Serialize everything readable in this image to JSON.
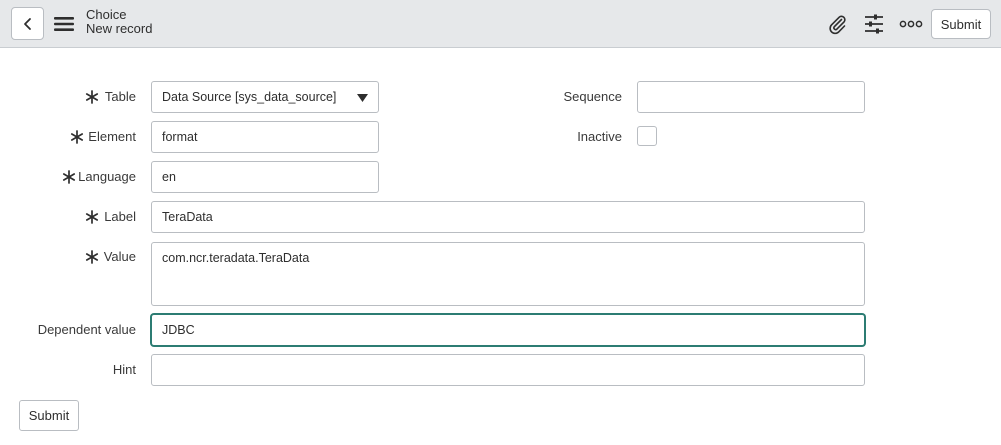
{
  "header": {
    "title": "Choice",
    "subtitle": "New record",
    "submit_label": "Submit",
    "icons": [
      "chevron-left-icon",
      "hamburger-menu-icon",
      "paperclip-icon",
      "sliders-icon",
      "more-options-icon"
    ]
  },
  "form": {
    "table": {
      "label": "Table",
      "required": true,
      "value": "Data Source [sys_data_source]"
    },
    "element": {
      "label": "Element",
      "required": true,
      "value": "format"
    },
    "language": {
      "label": "Language",
      "required": true,
      "value": "en"
    },
    "label_field": {
      "label": "Label",
      "required": true,
      "value": "TeraData"
    },
    "value_field": {
      "label": "Value",
      "required": true,
      "value": "com.ncr.teradata.TeraData"
    },
    "dependent_value": {
      "label": "Dependent value",
      "value": "JDBC"
    },
    "hint": {
      "label": "Hint",
      "value": ""
    },
    "sequence": {
      "label": "Sequence",
      "value": ""
    },
    "inactive": {
      "label": "Inactive",
      "checked": false
    },
    "submit_label": "Submit"
  },
  "colors": {
    "header_bg": "#e6e8ea",
    "focus_border": "#2c7c73"
  }
}
